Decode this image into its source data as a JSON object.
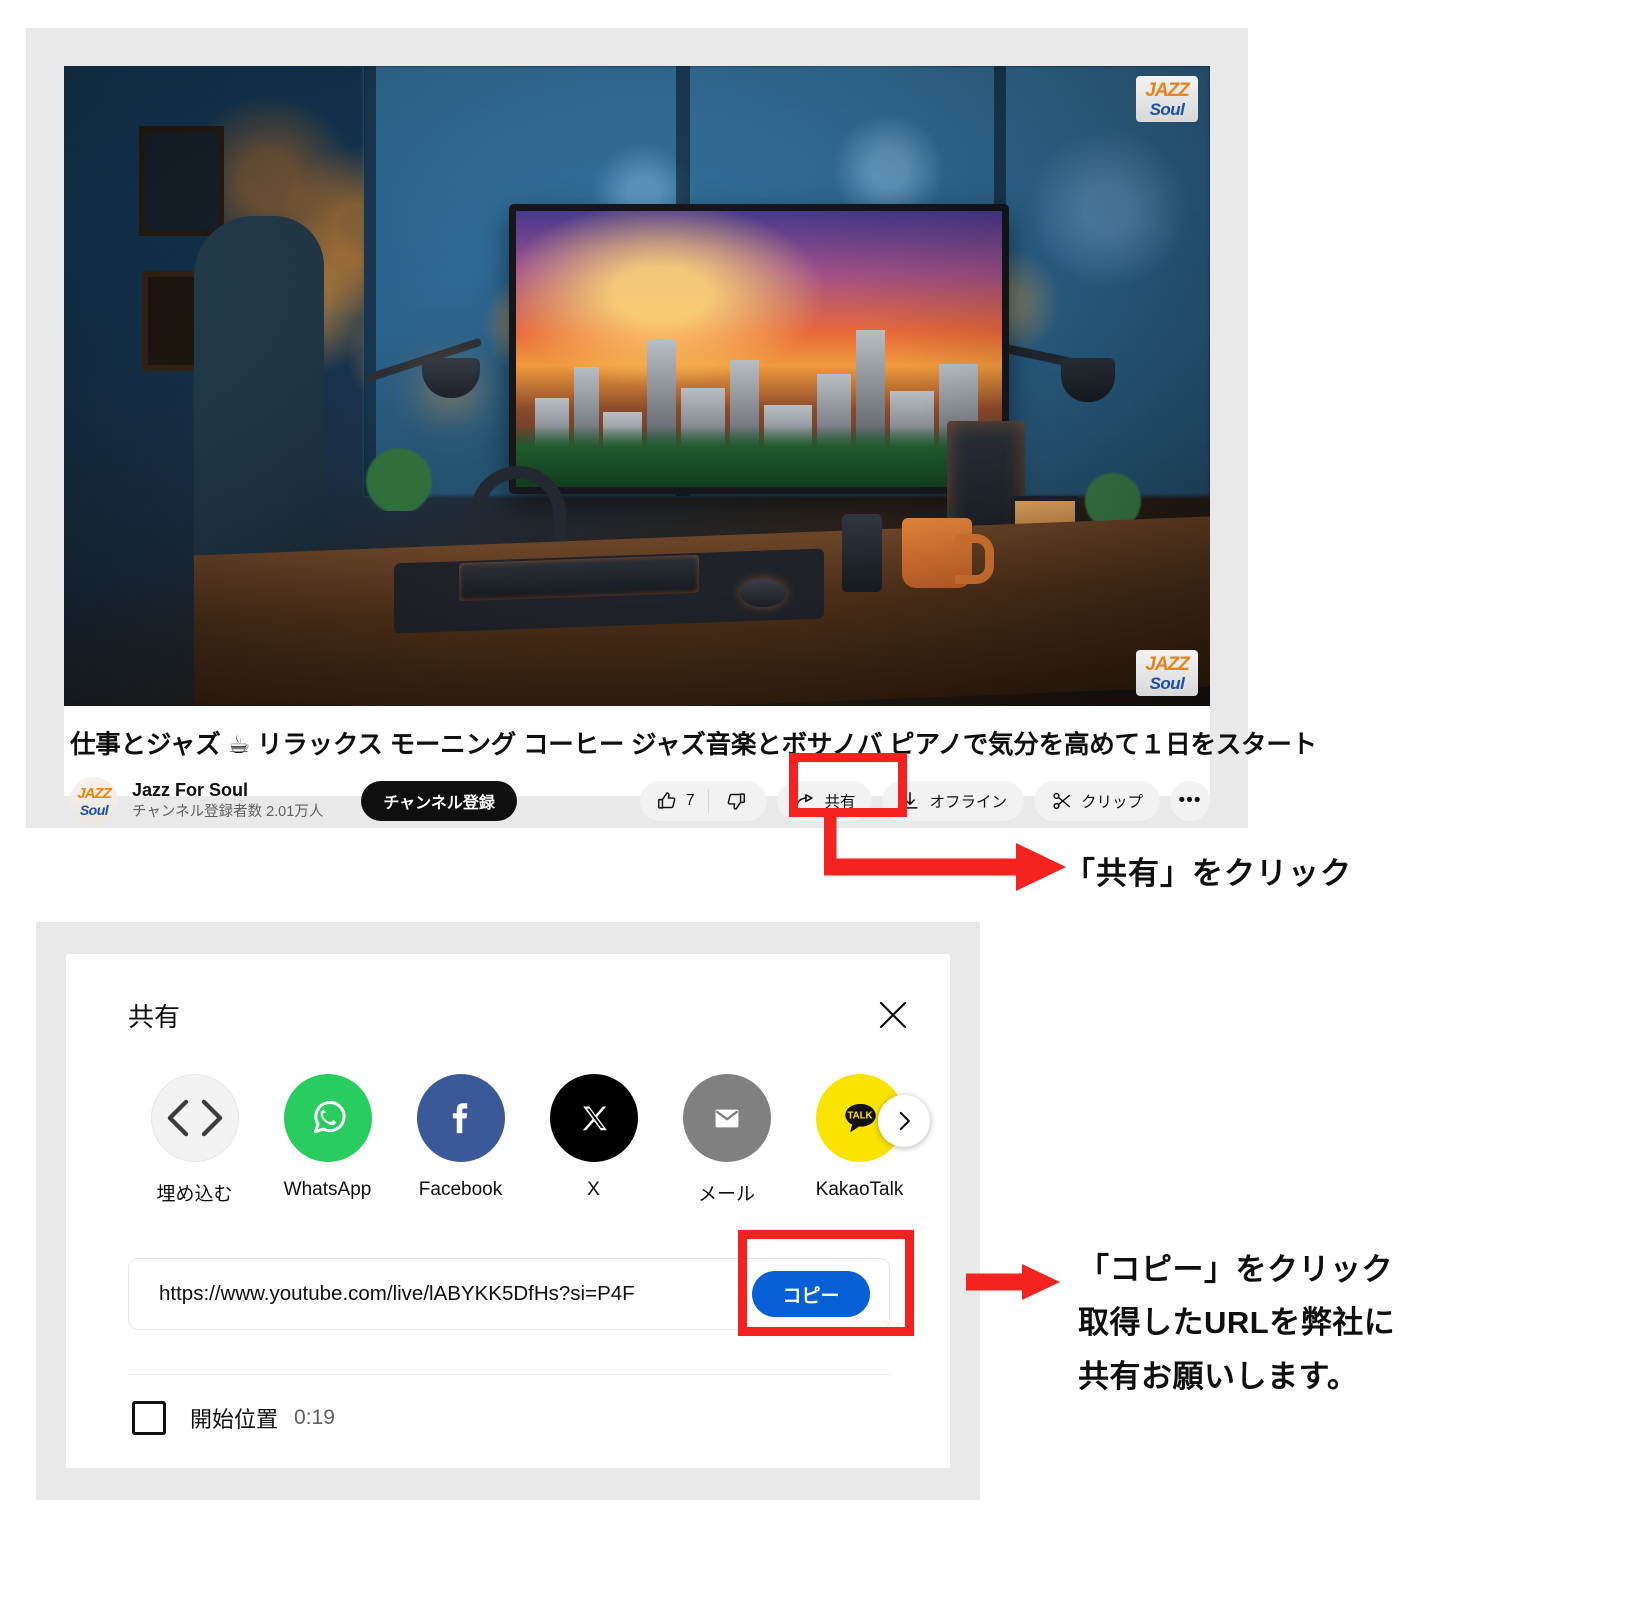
{
  "video": {
    "title": "仕事とジャズ ☕ リラックス モーニング コーヒー ジャズ音楽とボサノバ ピアノで気分を高めて１日をスタート",
    "channel_name": "Jazz For Soul",
    "subscriber_text": "チャンネル登録者数 2.01万人",
    "subscribe_label": "チャンネル登録",
    "watermark": {
      "line1": "JAZZ",
      "line2": "Soul"
    },
    "avatar": {
      "line1": "JAZZ",
      "line2": "Soul"
    },
    "actions": {
      "like_count": "7",
      "like_icon": "thumbs-up-icon",
      "dislike_icon": "thumbs-down-icon",
      "share_label": "共有",
      "share_icon": "share-arrow-icon",
      "offline_label": "オフライン",
      "offline_icon": "download-icon",
      "clip_label": "クリップ",
      "clip_icon": "scissors-icon",
      "more_label": "•••"
    }
  },
  "annotations": {
    "step1": "「共有」をクリック",
    "step2_line1": "「コピー」をクリック",
    "step2_line2": "取得したURLを弊社に",
    "step2_line3": "共有お願いします。",
    "highlight_color": "#f5231f"
  },
  "share_dialog": {
    "title": "共有",
    "close_icon": "close-icon",
    "next_icon": "chevron-right-icon",
    "apps": [
      {
        "label": "埋め込む",
        "icon": "code-brackets-icon",
        "color": "#f2f2f2"
      },
      {
        "label": "WhatsApp",
        "icon": "whatsapp-icon",
        "color": "#29cc5f"
      },
      {
        "label": "Facebook",
        "icon": "facebook-icon",
        "color": "#3b5998"
      },
      {
        "label": "X",
        "icon": "x-twitter-icon",
        "color": "#000000"
      },
      {
        "label": "メール",
        "icon": "envelope-icon",
        "color": "#808080"
      },
      {
        "label": "KakaoTalk",
        "icon": "kakaotalk-icon",
        "color": "#fbe300"
      }
    ],
    "url": "https://www.youtube.com/live/lABYKK5DfHs?si=P4F",
    "copy_label": "コピー",
    "copy_button_color": "#065fd4",
    "start_at_label": "開始位置",
    "start_at_time": "0:19",
    "start_at_checked": false
  }
}
